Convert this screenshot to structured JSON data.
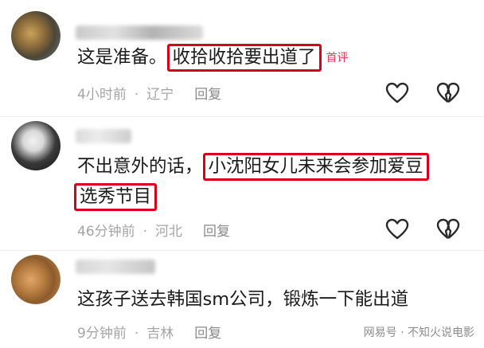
{
  "comments": [
    {
      "text_before": "这是准备。",
      "highlight": "收拾收拾要出道了",
      "tag": "首评",
      "time": "4小时前",
      "location": "辽宁",
      "reply": "回复"
    },
    {
      "text_before": "不出意外的话，",
      "highlight_line1": "小沈阳女儿未来会参加爱豆",
      "highlight_line2": "选秀节目",
      "time": "46分钟前",
      "location": "河北",
      "reply": "回复"
    },
    {
      "text": "这孩子送去韩国sm公司，锻炼一下能出道",
      "time": "9分钟前",
      "location": "吉林",
      "reply": "回复"
    }
  ],
  "separator": "·",
  "watermark": "网易号 · 不知火说电影",
  "icons": [
    "like-heart-icon",
    "dislike-broken-heart-icon"
  ]
}
